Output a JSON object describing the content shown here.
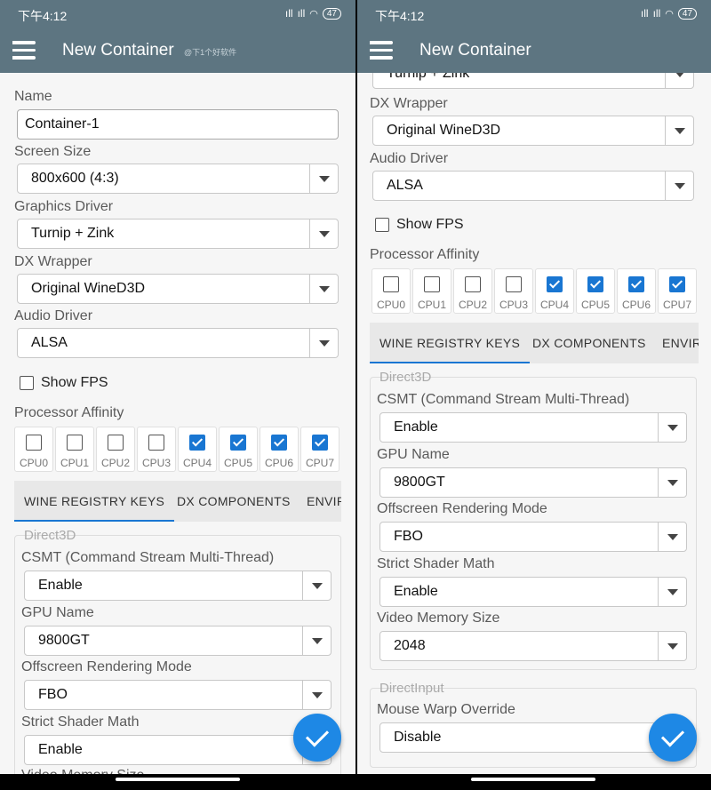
{
  "status": {
    "time": "下午4:12",
    "signal1": "ıll",
    "signal2": "ıll",
    "battery": "47"
  },
  "appbar": {
    "title": "New Container",
    "watermark": "@下1个好软件"
  },
  "labels": {
    "name": "Name",
    "screen_size": "Screen Size",
    "graphics_driver": "Graphics Driver",
    "dx_wrapper": "DX Wrapper",
    "audio_driver": "Audio Driver",
    "show_fps": "Show FPS",
    "processor_affinity": "Processor Affinity"
  },
  "values": {
    "name": "Container-1",
    "screen_size": "800x600 (4:3)",
    "graphics_driver": "Turnip + Zink",
    "dx_wrapper": "Original WineD3D",
    "audio_driver": "ALSA",
    "show_fps": false
  },
  "cpus": [
    {
      "label": "CPU0",
      "checked": false
    },
    {
      "label": "CPU1",
      "checked": false
    },
    {
      "label": "CPU2",
      "checked": false
    },
    {
      "label": "CPU3",
      "checked": false
    },
    {
      "label": "CPU4",
      "checked": true
    },
    {
      "label": "CPU5",
      "checked": true
    },
    {
      "label": "CPU6",
      "checked": true
    },
    {
      "label": "CPU7",
      "checked": true
    }
  ],
  "tabs": [
    "WINE REGISTRY KEYS",
    "DX COMPONENTS",
    "ENVIR"
  ],
  "direct3d": {
    "title": "Direct3D",
    "csmt_label": "CSMT (Command Stream Multi-Thread)",
    "csmt": "Enable",
    "gpu_name_label": "GPU Name",
    "gpu_name": "9800GT",
    "offscreen_label": "Offscreen Rendering Mode",
    "offscreen": "FBO",
    "shader_label": "Strict Shader Math",
    "shader": "Enable",
    "vram_label": "Video Memory Size",
    "vram": "2048"
  },
  "directinput": {
    "title": "DirectInput",
    "mouse_warp_label": "Mouse Warp Override",
    "mouse_warp": "Disable"
  },
  "colors": {
    "appbar": "#5d7581",
    "accent": "#1976d2",
    "fab": "#1e88e5"
  }
}
